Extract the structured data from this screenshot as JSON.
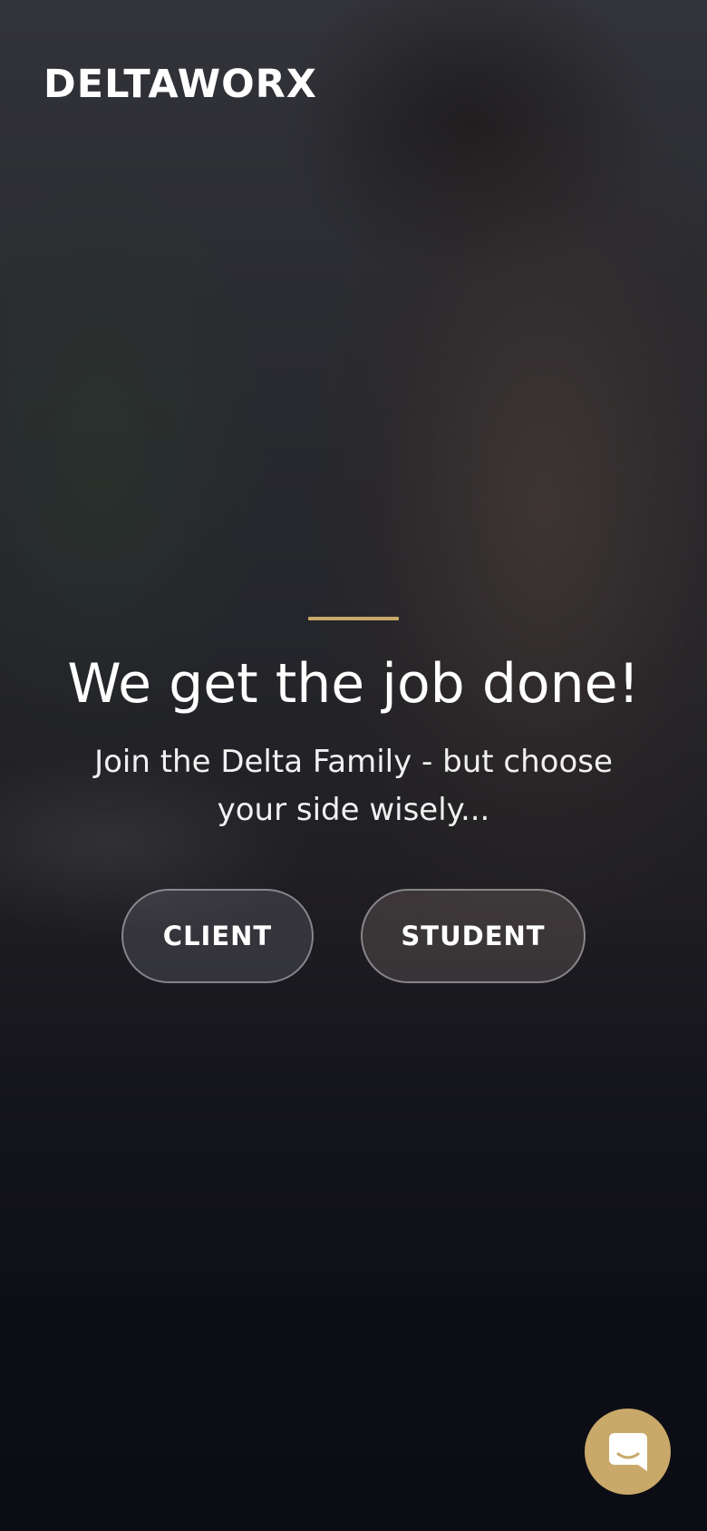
{
  "brand": {
    "logo_text": "DELTAWORX"
  },
  "hero": {
    "headline": "We get the job done!",
    "subline": "Join the Delta Family - but choose your side wisely..."
  },
  "actions": {
    "client_label": "CLIENT",
    "student_label": "STUDENT"
  },
  "chat": {
    "icon": "chat-bubble-icon"
  },
  "colors": {
    "accent": "#c9a96a",
    "text": "#ffffff",
    "background": "#0f1016"
  }
}
